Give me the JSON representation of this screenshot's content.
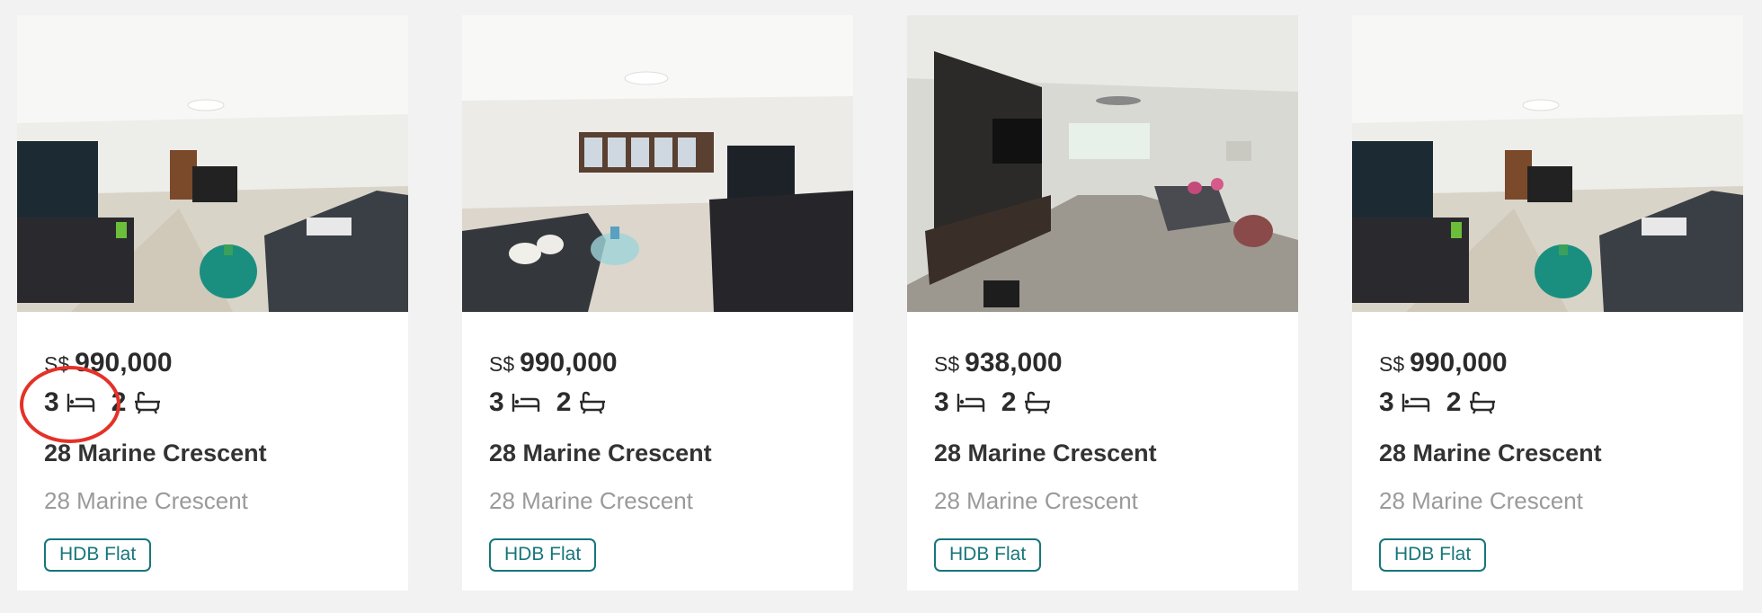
{
  "listings": [
    {
      "photo_icon": "living-room-photo",
      "currency": "S$",
      "price": "990,000",
      "bedrooms": "3",
      "bathrooms": "2",
      "title": "28 Marine Crescent",
      "address": "28 Marine Crescent",
      "type": "HDB Flat"
    },
    {
      "photo_icon": "living-room-photo",
      "currency": "S$",
      "price": "990,000",
      "bedrooms": "3",
      "bathrooms": "2",
      "title": "28 Marine Crescent",
      "address": "28 Marine Crescent",
      "type": "HDB Flat"
    },
    {
      "photo_icon": "living-room-photo",
      "currency": "S$",
      "price": "938,000",
      "bedrooms": "3",
      "bathrooms": "2",
      "title": "28 Marine Crescent",
      "address": "28 Marine Crescent",
      "type": "HDB Flat"
    },
    {
      "photo_icon": "living-room-photo",
      "currency": "S$",
      "price": "990,000",
      "bedrooms": "3",
      "bathrooms": "2",
      "title": "28 Marine Crescent",
      "address": "28 Marine Crescent",
      "type": "HDB Flat"
    }
  ],
  "icons": {
    "bed": "bed-icon",
    "bath": "bathtub-icon"
  },
  "colors": {
    "tag": "#17767a",
    "annotation": "#e53127",
    "price_text": "#2b2b2b",
    "muted_text": "#9a9a9a"
  }
}
